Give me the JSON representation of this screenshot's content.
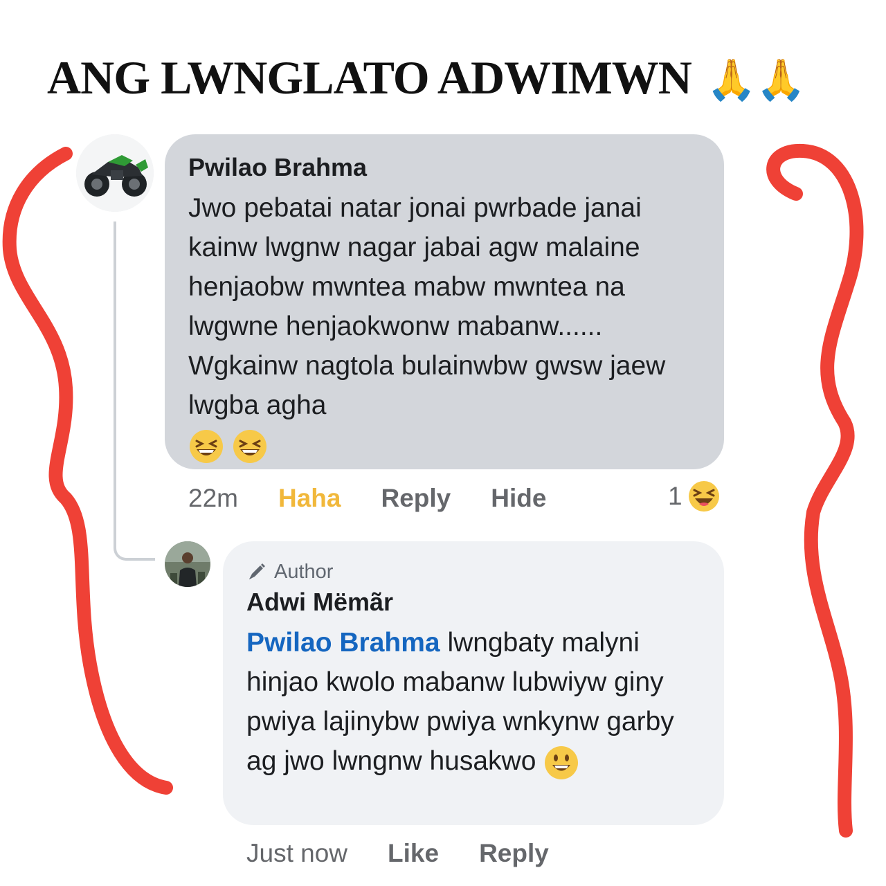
{
  "headline": {
    "text": "ANG LWNGLATO ADWIMWN",
    "emoji": "🙏🙏"
  },
  "comment": {
    "author": "Pwilao Brahma",
    "text": "Jwo pebatai natar jonai pwrbade janai kainw lwgnw nagar jabai agw malaine henjaobw mwntea mabw mwntea na lwgwne henjaokwonw mabanw...... Wgkainw nagtola bulainwbw gwsw jaew lwgba agha",
    "emoji_icons": [
      "grinning-squinting-face-icon",
      "grinning-squinting-face-icon"
    ],
    "time": "22m",
    "reaction_label": "Haha",
    "reply_label": "Reply",
    "hide_label": "Hide",
    "reaction_count": "1",
    "reaction_icon": "laughing-face-icon"
  },
  "reply": {
    "badge": "Author",
    "author": "Adwi Mëmãr",
    "mention": "Pwilao Brahma",
    "text": "lwngbaty malyni hinjao kwolo mabanw lubwiyw giny pwiya lajinybw pwiya wnkynw garby ag jwo lwngnw husakwo",
    "emoji_icon": "grinning-face-icon",
    "time": "Just now",
    "like_label": "Like",
    "reply_label": "Reply"
  },
  "colors": {
    "curve": "#ef4136",
    "mention": "#1566c0",
    "haha": "#f1b83b",
    "bubble_dark": "#d3d6db",
    "bubble_light": "#f0f2f5"
  }
}
